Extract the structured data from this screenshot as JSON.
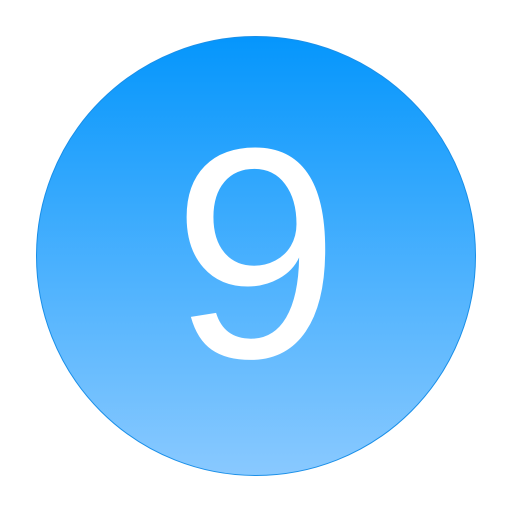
{
  "badge": {
    "number": "9",
    "gradient_top": "#0596fc",
    "gradient_bottom": "#89c9ff",
    "text_color": "#ffffff"
  }
}
